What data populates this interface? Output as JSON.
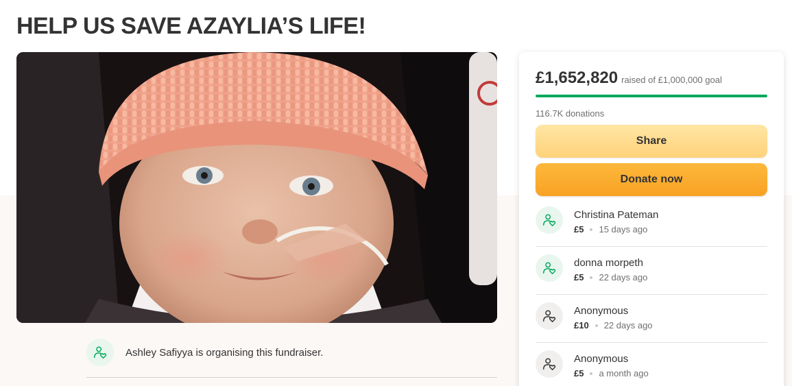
{
  "page": {
    "title": "HELP US SAVE AZAYLIA’S LIFE!"
  },
  "hero": {
    "alt": "Baby wearing a pink knitted hat with a nasal feeding tube"
  },
  "organiser": {
    "text": "Ashley Safiyya is organising this fundraiser.",
    "icon": "person-heart-icon"
  },
  "card": {
    "raised": "£1,652,820",
    "goal_text": "raised of £1,000,000 goal",
    "progress_fraction": 1.0,
    "donations_count": "116.7K donations",
    "share_label": "Share",
    "donate_label": "Donate now",
    "donors": [
      {
        "name": "Christina Pateman",
        "amount": "£5",
        "time": "15 days ago",
        "icon": "person-heart-icon"
      },
      {
        "name": "donna morpeth",
        "amount": "£5",
        "time": "22 days ago",
        "icon": "person-heart-icon"
      },
      {
        "name": "Anonymous",
        "amount": "£10",
        "time": "22 days ago",
        "icon": "person-heart-icon"
      },
      {
        "name": "Anonymous",
        "amount": "£5",
        "time": "a month ago",
        "icon": "person-heart-icon"
      }
    ]
  },
  "colors": {
    "brand_green": "#02a95c",
    "share_yellow": "#ffd98f",
    "donate_orange": "#f9ab2c",
    "page_beige": "#fbf8f6",
    "text_dark": "#333333"
  }
}
